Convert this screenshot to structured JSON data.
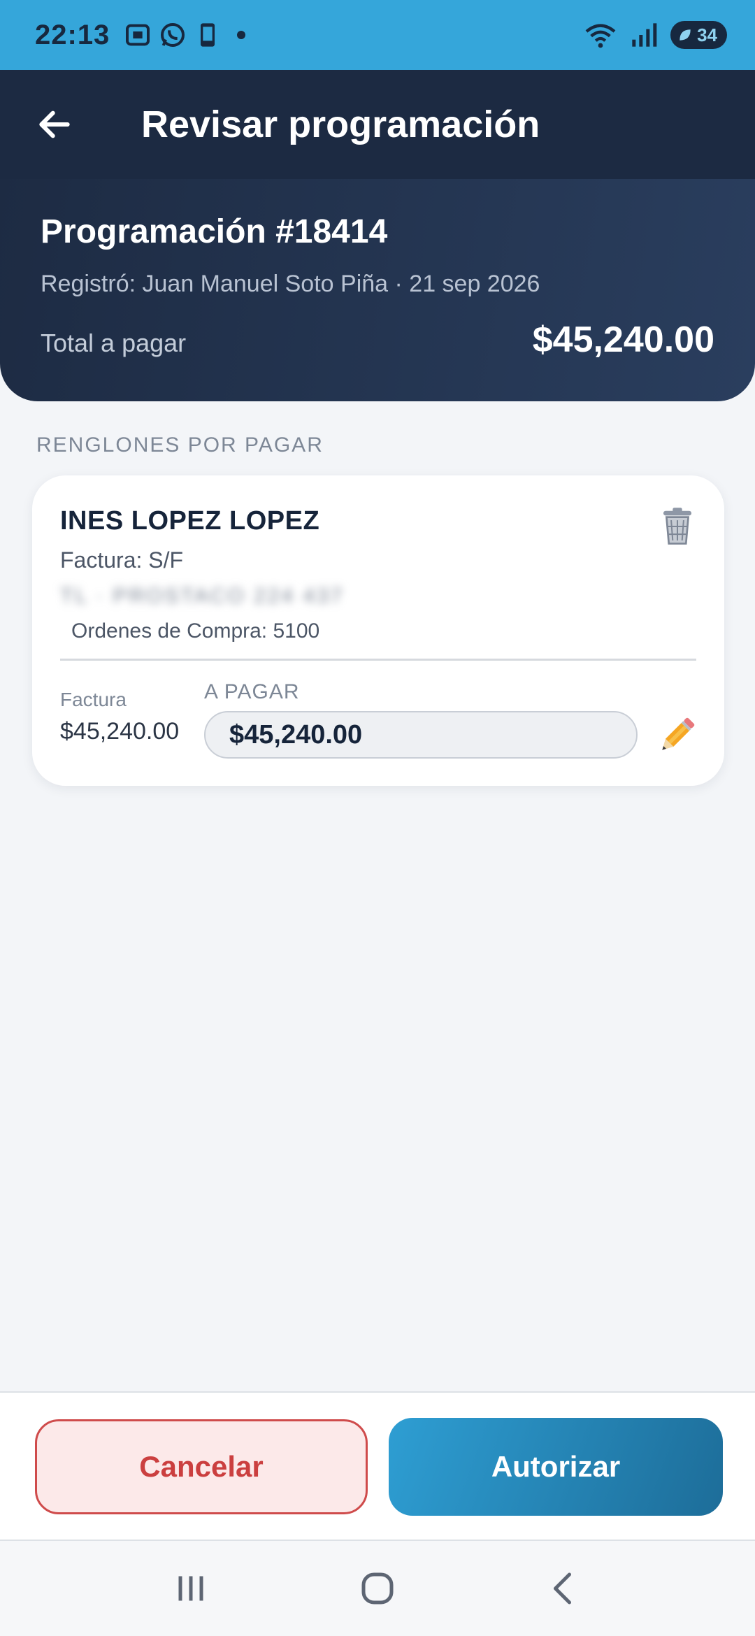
{
  "status_bar": {
    "time": "22:13",
    "battery": "34",
    "colors": {
      "background": "#35a6da",
      "foreground": "#17283f"
    },
    "left_icons": [
      "screenshot-icon",
      "whatsapp-icon",
      "phone-device-icon",
      "notification-dot-icon"
    ],
    "right_icons": [
      "wifi-icon",
      "signal-icon",
      "battery-icon"
    ]
  },
  "header": {
    "title": "Revisar programación",
    "back_icon": "arrow-left-icon"
  },
  "summary": {
    "program_number": "Programación #18414",
    "registered_by": "Registró: Juan Manuel Soto Piña · 21 sep 2026",
    "total_label": "Total a pagar",
    "total_value": "$45,240.00"
  },
  "section_label": "RENGLONES POR PAGAR",
  "items": [
    {
      "vendor": "INES LOPEZ LOPEZ",
      "invoice": "Factura: S/F",
      "blurred_text": "TL · PROSTACO 224 437",
      "purchase_orders": "Ordenes de Compra: 5100",
      "invoice_label": "Factura",
      "invoice_amount": "$45,240.00",
      "pay_label": "A PAGAR",
      "pay_value": "$45,240.00",
      "icons": [
        "trash-icon",
        "pencil-icon"
      ]
    }
  ],
  "actions": {
    "cancel_label": "Cancelar",
    "authorize_label": "Autorizar",
    "colors": {
      "cancel": "#cb3f3f",
      "authorize": "#2e9ed3"
    }
  },
  "nav": {
    "icons": [
      "recents-icon",
      "home-icon",
      "back-icon"
    ]
  }
}
